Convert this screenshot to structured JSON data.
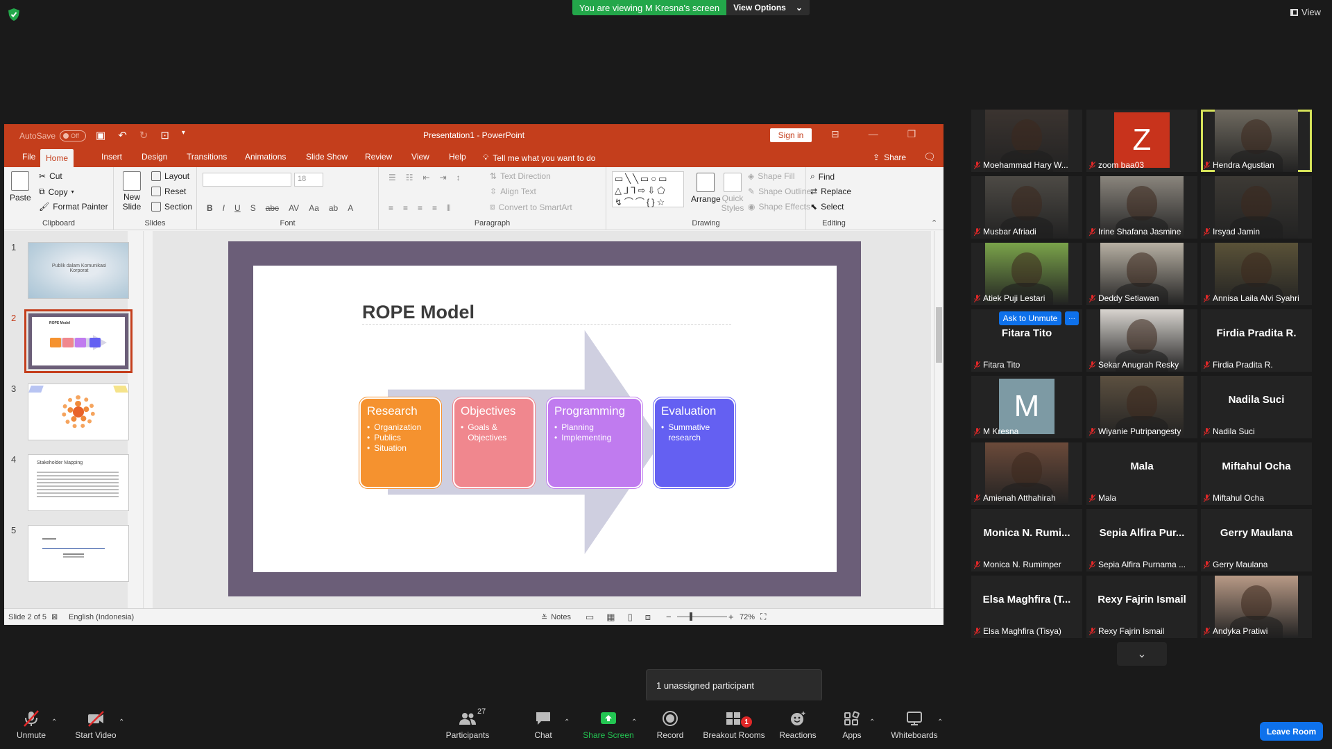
{
  "zoom": {
    "viewing_banner": "You are viewing M Kresna's screen",
    "view_options": "View Options",
    "view_label": "View",
    "unassigned_tooltip": "1 unassigned participant",
    "leave_room": "Leave Room",
    "ask_to_unmute": "Ask to Unmute",
    "ask_more": "···",
    "toolbar": {
      "unmute": "Unmute",
      "start_video": "Start Video",
      "participants": "Participants",
      "participants_count": "27",
      "chat": "Chat",
      "share_screen": "Share Screen",
      "record": "Record",
      "breakout_rooms": "Breakout Rooms",
      "breakout_badge": "1",
      "reactions": "Reactions",
      "apps": "Apps",
      "whiteboards": "Whiteboards"
    },
    "participants": [
      {
        "name": "Moehammad Hary W...",
        "video": true,
        "bg": "#3b3430"
      },
      {
        "name": "zoom baa03",
        "initial": "Z",
        "bg": "#c8331c"
      },
      {
        "name": "Hendra Agustian",
        "video": true,
        "bg": "#6f6a60",
        "speaking": true
      },
      {
        "name": "Musbar Afriadi",
        "video": true,
        "bg": "#4d4a45"
      },
      {
        "name": "Irine Shafana Jasmine",
        "video": true,
        "bg": "#8a857d"
      },
      {
        "name": "Irsyad Jamin",
        "video": true,
        "bg": "#3d3a35"
      },
      {
        "name": "Atiek Puji Lestari",
        "video": true,
        "bg": "#7aa34a"
      },
      {
        "name": "Deddy Setiawan",
        "video": true,
        "bg": "#b7b0a3"
      },
      {
        "name": "Annisa Laila Alvi Syahri",
        "video": true,
        "bg": "#5a5238"
      },
      {
        "name": "Fitara Tito",
        "big": "Fitara Tito"
      },
      {
        "name": "Sekar Anugrah Resky",
        "video": true,
        "bg": "#d8d4cf"
      },
      {
        "name": "Firdia Pradita R.",
        "big": "Firdia Pradita R."
      },
      {
        "name": "M Kresna",
        "initial": "M",
        "bg": "#7d9aa4"
      },
      {
        "name": "Wiyanie Putripangesty",
        "video": true,
        "bg": "#5c5040"
      },
      {
        "name": "Nadila Suci",
        "big": "Nadila Suci"
      },
      {
        "name": "Amienah Atthahirah",
        "video": true,
        "bg": "#6b4a3a"
      },
      {
        "name": "Mala",
        "big": "Mala"
      },
      {
        "name": "Miftahul Ocha",
        "big": "Miftahul Ocha"
      },
      {
        "name": "Monica N. Rumimper",
        "big": "Monica N. Rumi..."
      },
      {
        "name": "Sepia Alfira Purnama ...",
        "big": "Sepia Alfira Pur..."
      },
      {
        "name": "Gerry Maulana",
        "big": "Gerry Maulana"
      },
      {
        "name": "Elsa Maghfira (Tisya)",
        "big": "Elsa Maghfira (T..."
      },
      {
        "name": "Rexy Fajrin Ismail",
        "big": "Rexy Fajrin Ismail"
      },
      {
        "name": "Andyka Pratiwi",
        "video": true,
        "bg": "#b89a86"
      }
    ]
  },
  "ppt": {
    "autosave": "AutoSave",
    "autosave_state": "Off",
    "doc_title": "Presentation1  -  PowerPoint",
    "sign_in": "Sign in",
    "tabs": [
      "File",
      "Home",
      "Insert",
      "Design",
      "Transitions",
      "Animations",
      "Slide Show",
      "Review",
      "View",
      "Help"
    ],
    "active_tab": "Home",
    "tell_me": "Tell me what you want to do",
    "share": "Share",
    "ribbon": {
      "paste": "Paste",
      "cut": "Cut",
      "copy": "Copy",
      "format_painter": "Format Painter",
      "clipboard": "Clipboard",
      "new_slide": "New Slide",
      "layout": "Layout",
      "reset": "Reset",
      "section": "Section",
      "slides": "Slides",
      "font_size": "18",
      "font": "Font",
      "text_direction": "Text Direction",
      "align_text": "Align Text",
      "convert_smartart": "Convert to SmartArt",
      "paragraph": "Paragraph",
      "arrange": "Arrange",
      "quick_styles": "Quick Styles",
      "shape_fill": "Shape Fill",
      "shape_outline": "Shape Outline",
      "shape_effects": "Shape Effects",
      "drawing": "Drawing",
      "find": "Find",
      "replace": "Replace",
      "select": "Select",
      "editing": "Editing"
    },
    "thumbnails": [
      {
        "num": "1",
        "text": "Publik dalam Komunikasi Korporat"
      },
      {
        "num": "2",
        "text": "ROPE Model"
      },
      {
        "num": "3",
        "text": ""
      },
      {
        "num": "4",
        "text": "Stakeholder Mapping"
      },
      {
        "num": "5",
        "text": ""
      }
    ],
    "slide": {
      "title": "ROPE Model",
      "boxes": [
        {
          "title": "Research",
          "items": [
            "Organization",
            "Publics",
            "Situation"
          ],
          "color": "#f5922f"
        },
        {
          "title": "Objectives",
          "items": [
            "Goals & Objectives"
          ],
          "color": "#f0878e"
        },
        {
          "title": "Programming",
          "items": [
            "Planning",
            "Implementing"
          ],
          "color": "#c07bef"
        },
        {
          "title": "Evaluation",
          "items": [
            "Summative research"
          ],
          "color": "#6460f2"
        }
      ]
    },
    "status": {
      "slide_of": "Slide 2 of 5",
      "language": "English (Indonesia)",
      "notes": "Notes",
      "zoom": "72%"
    }
  }
}
